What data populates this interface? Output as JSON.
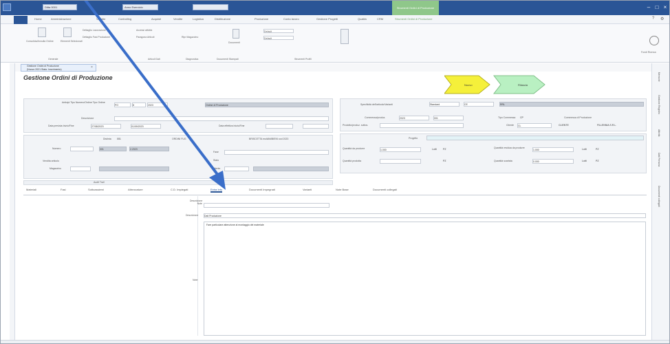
{
  "titlebar": {
    "field1": "Ditta 0001",
    "field2": "Anno Esercizio",
    "field3": "",
    "context_tab": "Strumenti Ordini di Produzione"
  },
  "menu": {
    "items": [
      "Home",
      "Amministrazione",
      "Vendite",
      "Controlling",
      "Acquisti",
      "Vendite",
      "Logistica",
      "Distribuzione",
      "Produzione",
      "Conto lavoro",
      "Gestione Progetti",
      "Qualità",
      "CRM",
      "Strumenti Ordini di Produzione"
    ]
  },
  "ribbon": {
    "group1_label": "Generale",
    "group2_label": "Articoli Dati",
    "group3_label": "Diagnostica",
    "group4_label": "Documenti Stampati",
    "group5_label": "Strumenti Profili",
    "btn_consolida": "Consolida/Annulla Ordine",
    "btn_elementi": "Elementi Selezionati",
    "chk1": "Dettaglio Lavorazione",
    "chk2": "Dettaglio Fasi Produzione",
    "chk3": "Accessi attività",
    "chk4": "Paragona Articoli",
    "chk5": "Ripr Magazzino",
    "btn_documenti": "Documenti",
    "sel1": "Default",
    "sel2": "Default",
    "right_label": "Fondi Ricerca"
  },
  "doc_tab": {
    "line1": "Gestione Ordini di Produzione",
    "line2": "(Nuovo 2021 Stato: Inserimento)",
    "close": "×"
  },
  "page_title": "Gestione Ordini di Produzione",
  "flow": {
    "step1": "Nuovo",
    "step2": "Rilascia"
  },
  "header_panel": {
    "lbl_tipo": "Anticipi Tipo Numero/Ordine Tipo Ordine",
    "val_num1": "PO",
    "val_num2": "8",
    "val_year": "2023",
    "val_tipo": "Ordine di Produzione",
    "lbl_descrizione": "Descrizione",
    "lbl_data_prevista": "Data prevista Inizio/Fine",
    "val_data1": "27/08/2023",
    "val_data2": "01/09/2023",
    "lbl_data_effettiva": "Data effettiva Inizio/Fine",
    "lbl_distinta": "Distinta",
    "val_distinta": "001",
    "lbl_ordini": "ORDINI FUG",
    "lbl_articolo_mat": "BRISCETTA multiAMBIENI cod 2023",
    "lbl_numero": "Numero",
    "val_numero": "001",
    "val_numero2": "2.2023",
    "lbl_vendita": "Vendita articolo",
    "lbl_magazzino": "Magazzino",
    "lbl_fase": "Fase",
    "lbl_stato": "Stato",
    "lbl_utente": "Utente"
  },
  "right_panel": {
    "lbl_specifiche": "Specificità dell'articolo/Varianti",
    "val_spec1": "Standard",
    "val_spec2": "CE",
    "val_spec3": "RRL",
    "lbl_commessa": "Commessa/produz.",
    "val_comm1": "2023",
    "val_comm2": "001",
    "lbl_tipo_commessa": "Tipo Commessa",
    "val_tipo_comm": "CP",
    "lbl_commessa_prod": "Commessa di Produzione",
    "lbl_prodotto": "Prodotto/produz. sottos.",
    "lbl_cliente": "Cliente",
    "val_cliente_cod": "CL",
    "val_cliente": "CLIENTE",
    "val_cliente2": "FILLENNIA S.R.L.",
    "lbl_progetto": "Progetto",
    "lbl_qta_prod": "Quantità da produrre",
    "val_qta_prod": "1.000",
    "val_um1": "Lotti",
    "val_um2": "PZ",
    "lbl_qta_prodotta": "Quantità prodotta",
    "val_um3": "PZ",
    "lbl_qta_residua": "Quantità residua da produrre",
    "val_qta_res": "1.000",
    "val_um4": "Lotti",
    "val_um5": "PZ",
    "lbl_qta_scarto": "Quantità scartata",
    "val_qta_scarto": "0.000",
    "val_um6": "Lotti",
    "val_um7": "PZ"
  },
  "audit": {
    "label": "Audit Trail"
  },
  "tabs": {
    "items": [
      "Materiali",
      "Fasi",
      "Sottoassiemi",
      "Attrezzature",
      "C.D. Impiegati",
      "Extra Info",
      "Documenti Impegnati",
      "Varianti",
      "Note Base",
      "Documenti collegati"
    ],
    "active_index": 5
  },
  "notes": {
    "lbl_descrizione_note": "Descrizione Note",
    "lbl_descrizione": "Descrizione",
    "val_descrizione": "Dati Produzione",
    "text": "Fare particolare attenzione al montaggio del materiale",
    "lbl_note": "Note"
  },
  "right_dock": {
    "items": [
      "Memorie",
      "Gestione Registro",
      "Attività",
      "Dati Persona",
      "Documenti collegati"
    ]
  },
  "colors": {
    "titlebar": "#2a5596",
    "flow_step1": "#f5f03a",
    "flow_step2": "#b9f0c2",
    "arrow": "#3a6ec9"
  }
}
